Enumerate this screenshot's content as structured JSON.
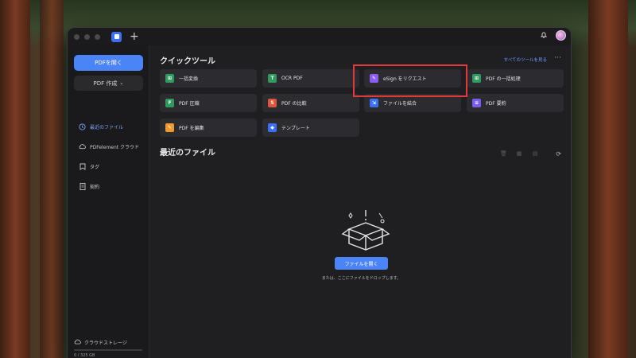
{
  "colors": {
    "accent": "#4a84f6",
    "highlight": "#e23a3a",
    "window_bg": "#1e1e21"
  },
  "titlebar": {
    "new_tab_label": "+"
  },
  "sidebar": {
    "open_button": "PDFを開く",
    "create_button": "PDF 作成",
    "items": [
      {
        "label": "最近のファイル",
        "icon": "clock-icon",
        "active": true
      },
      {
        "label": "PDFelement クラウド",
        "icon": "cloud-icon",
        "active": false
      },
      {
        "label": "タグ",
        "icon": "tag-icon",
        "active": false
      },
      {
        "label": "契約",
        "icon": "document-icon",
        "active": false
      }
    ],
    "storage_label": "クラウドストレージ",
    "storage_size": "0 / 325 GB"
  },
  "main": {
    "quick_tools_title": "クイックツール",
    "see_all_label": "すべてのツールを見る",
    "more_label": "···",
    "tools": [
      {
        "label": "一括変換",
        "icon": "batch-convert-icon",
        "color": "#2e9a5e"
      },
      {
        "label": "OCR PDF",
        "icon": "ocr-icon",
        "color": "#2e9a5e"
      },
      {
        "label": "eSign をリクエスト",
        "icon": "esign-icon",
        "color": "#8a5cf0"
      },
      {
        "label": "PDF の一括処理",
        "icon": "batch-process-icon",
        "color": "#2e9a5e"
      },
      {
        "label": "PDF 圧縮",
        "icon": "compress-icon",
        "color": "#2e9a5e"
      },
      {
        "label": "PDF の比較",
        "icon": "compare-icon",
        "color": "#e0543a"
      },
      {
        "label": "ファイルを結合",
        "icon": "merge-icon",
        "color": "#3a6ff7"
      },
      {
        "label": "PDF 要約",
        "icon": "summary-icon",
        "color": "#7a5cf0"
      },
      {
        "label": "PDF を編集",
        "icon": "edit-icon",
        "color": "#f09a2e"
      },
      {
        "label": "テンプレート",
        "icon": "template-icon",
        "color": "#3a6ff7"
      }
    ],
    "recent_title": "最近のファイル",
    "open_file_button": "ファイルを開く",
    "drop_hint": "または、ここにファイルをドロップします。"
  }
}
